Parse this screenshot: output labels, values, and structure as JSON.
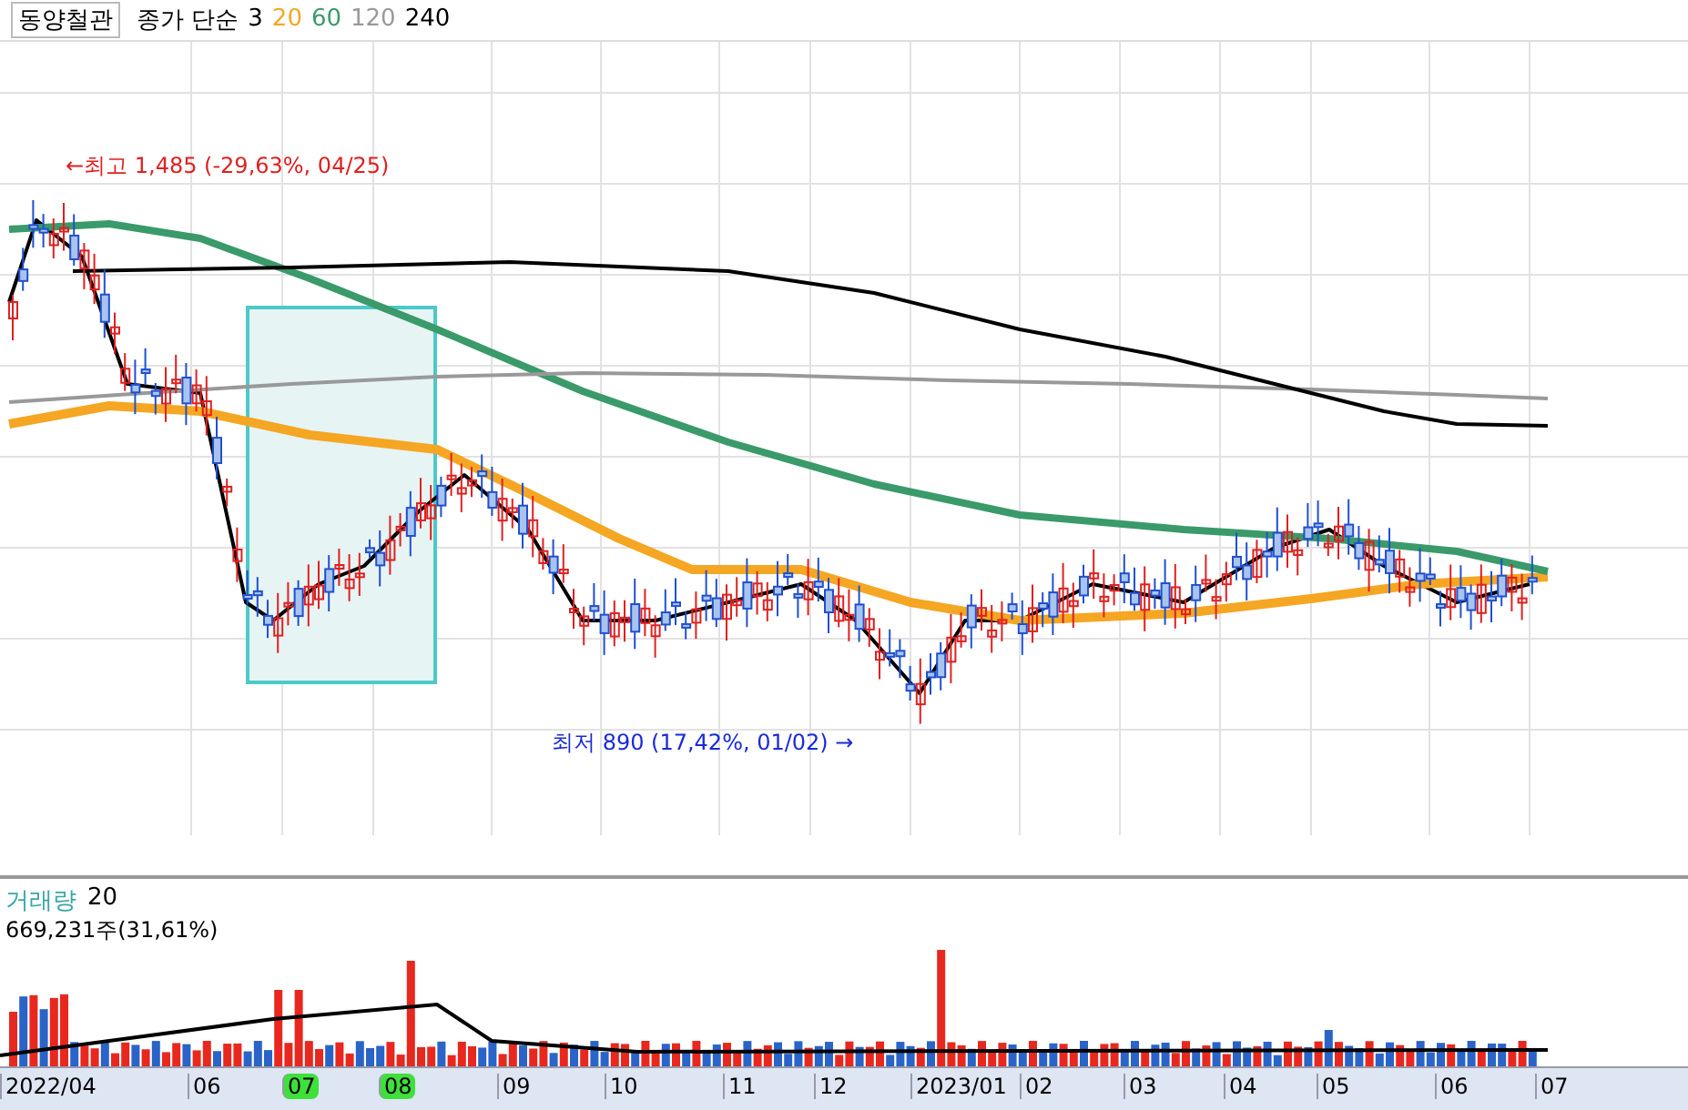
{
  "header": {
    "stock_name": "동양철관",
    "indicator_label": "종가 단순",
    "moving_averages": [
      {
        "label": "3",
        "color": "#000000"
      },
      {
        "label": "20",
        "color": "#f5a623"
      },
      {
        "label": "60",
        "color": "#3a9a6a"
      },
      {
        "label": "120",
        "color": "#999999"
      },
      {
        "label": "240",
        "color": "#000000"
      }
    ]
  },
  "price_chart": {
    "high_annotation": "←최고 1,485 (-29,63%, 04/25)",
    "low_annotation": "최저 890 (17,42%, 01/02) →"
  },
  "volume_panel": {
    "title": "거래량",
    "period": "20",
    "reading": "669,231주(31,61%)"
  },
  "x_axis": [
    {
      "label": "2022/04",
      "highlighted": false
    },
    {
      "label": "06",
      "highlighted": false
    },
    {
      "label": "07",
      "highlighted": true
    },
    {
      "label": "08",
      "highlighted": true
    },
    {
      "label": "09",
      "highlighted": false
    },
    {
      "label": "10",
      "highlighted": false
    },
    {
      "label": "11",
      "highlighted": false
    },
    {
      "label": "12",
      "highlighted": false
    },
    {
      "label": "2023/01",
      "highlighted": false
    },
    {
      "label": "02",
      "highlighted": false
    },
    {
      "label": "03",
      "highlighted": false
    },
    {
      "label": "04",
      "highlighted": false
    },
    {
      "label": "05",
      "highlighted": false
    },
    {
      "label": "06",
      "highlighted": false
    },
    {
      "label": "07",
      "highlighted": false
    }
  ]
}
